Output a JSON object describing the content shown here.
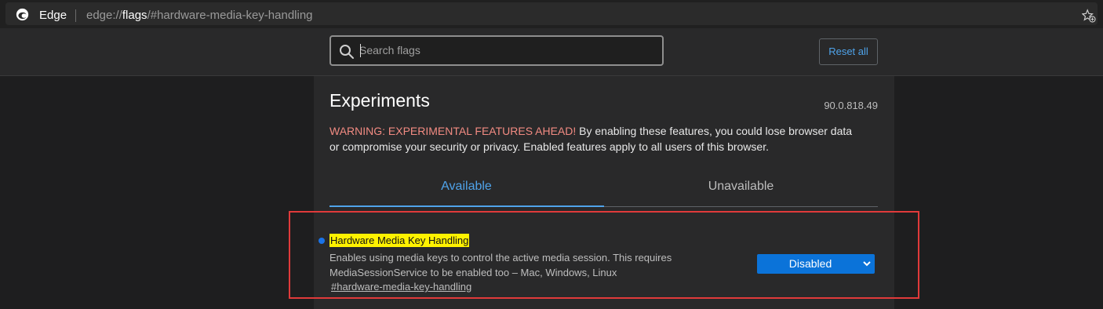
{
  "browser": {
    "brand": "Edge",
    "url_scheme": "edge://",
    "url_host": "flags",
    "url_path": "/#hardware-media-key-handling",
    "favorites_icon": "star-add-icon"
  },
  "header": {
    "search_placeholder": "Search flags",
    "search_value": "",
    "reset_label": "Reset all"
  },
  "page": {
    "title": "Experiments",
    "version": "90.0.818.49",
    "warning_strong": "WARNING: EXPERIMENTAL FEATURES AHEAD!",
    "warning_text": " By enabling these features, you could lose browser data or compromise your security or privacy. Enabled features apply to all users of this browser."
  },
  "tabs": [
    {
      "label": "Available",
      "active": true
    },
    {
      "label": "Unavailable",
      "active": false
    }
  ],
  "experiment": {
    "name": "Hardware Media Key Handling",
    "description": "Enables using media keys to control the active media session. This requires MediaSessionService to be enabled too – Mac, Windows, Linux",
    "link": "#hardware-media-key-handling",
    "selected_option": "Disabled"
  },
  "colors": {
    "accent": "#4fa3ea",
    "highlight": "#fff200",
    "warning": "#f28b82",
    "annotation": "#e03a3a",
    "select_bg": "#0b73d9"
  }
}
